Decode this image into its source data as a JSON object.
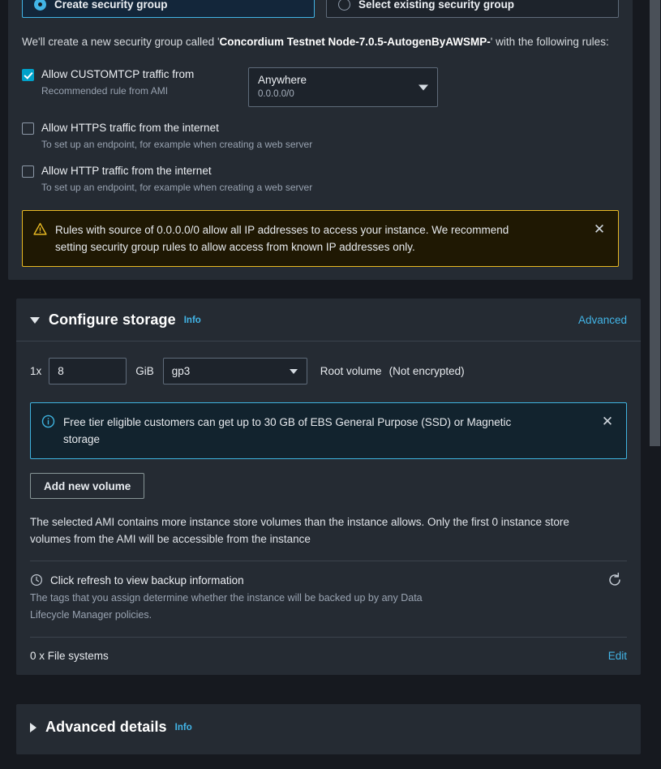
{
  "security_group": {
    "options": [
      {
        "label": "Create security group",
        "selected": true
      },
      {
        "label": "Select existing security group",
        "selected": false
      }
    ],
    "intro_prefix": "We'll create a new security group called '",
    "group_name": "Concordium Testnet Node-7.0.5-AutogenByAWSMP-",
    "intro_suffix": "' with the following rules:",
    "rules": [
      {
        "title": "Allow CUSTOMTCP traffic from",
        "subtitle": "Recommended rule from AMI",
        "checked": true,
        "source": {
          "value": "Anywhere",
          "cidr": "0.0.0.0/0"
        }
      },
      {
        "title": "Allow HTTPS traffic from the internet",
        "subtitle": "To set up an endpoint, for example when creating a web server",
        "checked": false
      },
      {
        "title": "Allow HTTP traffic from the internet",
        "subtitle": "To set up an endpoint, for example when creating a web server",
        "checked": false
      }
    ],
    "warning": {
      "icon": "warning-triangle-icon",
      "text": "Rules with source of 0.0.0.0/0 allow all IP addresses to access your instance. We recommend setting security group rules to allow access from known IP addresses only.",
      "dismiss": "✕"
    }
  },
  "configure_storage": {
    "title": "Configure storage",
    "info_label": "Info",
    "advanced_label": "Advanced",
    "volume": {
      "count": "1x",
      "size": "8",
      "unit": "GiB",
      "type": "gp3",
      "description": "Root volume",
      "encryption": "(Not encrypted)"
    },
    "info_banner": {
      "icon": "info-circle-icon",
      "text": "Free tier eligible customers can get up to 30 GB of EBS General Purpose (SSD) or Magnetic storage",
      "dismiss": "✕"
    },
    "add_volume_label": "Add new volume",
    "ami_note": "The selected AMI contains more instance store volumes than the instance allows. Only the first 0 instance store volumes from the AMI will be accessible from the instance",
    "backup": {
      "icon": "clock-icon",
      "title": "Click refresh to view backup information",
      "subtitle": "The tags that you assign determine whether the instance will be backed up by any Data Lifecycle Manager policies.",
      "refresh_icon": "refresh-icon"
    },
    "file_systems": {
      "label": "0 x File systems",
      "edit_label": "Edit"
    }
  },
  "advanced_details": {
    "title": "Advanced details",
    "info_label": "Info"
  },
  "colors": {
    "accent": "#42b4e6",
    "warning_border": "#e8b923",
    "info_border": "#3fb4e0",
    "checkbox_on": "#00a1c9",
    "card_bg": "#252b33",
    "page_bg": "#16191f"
  }
}
